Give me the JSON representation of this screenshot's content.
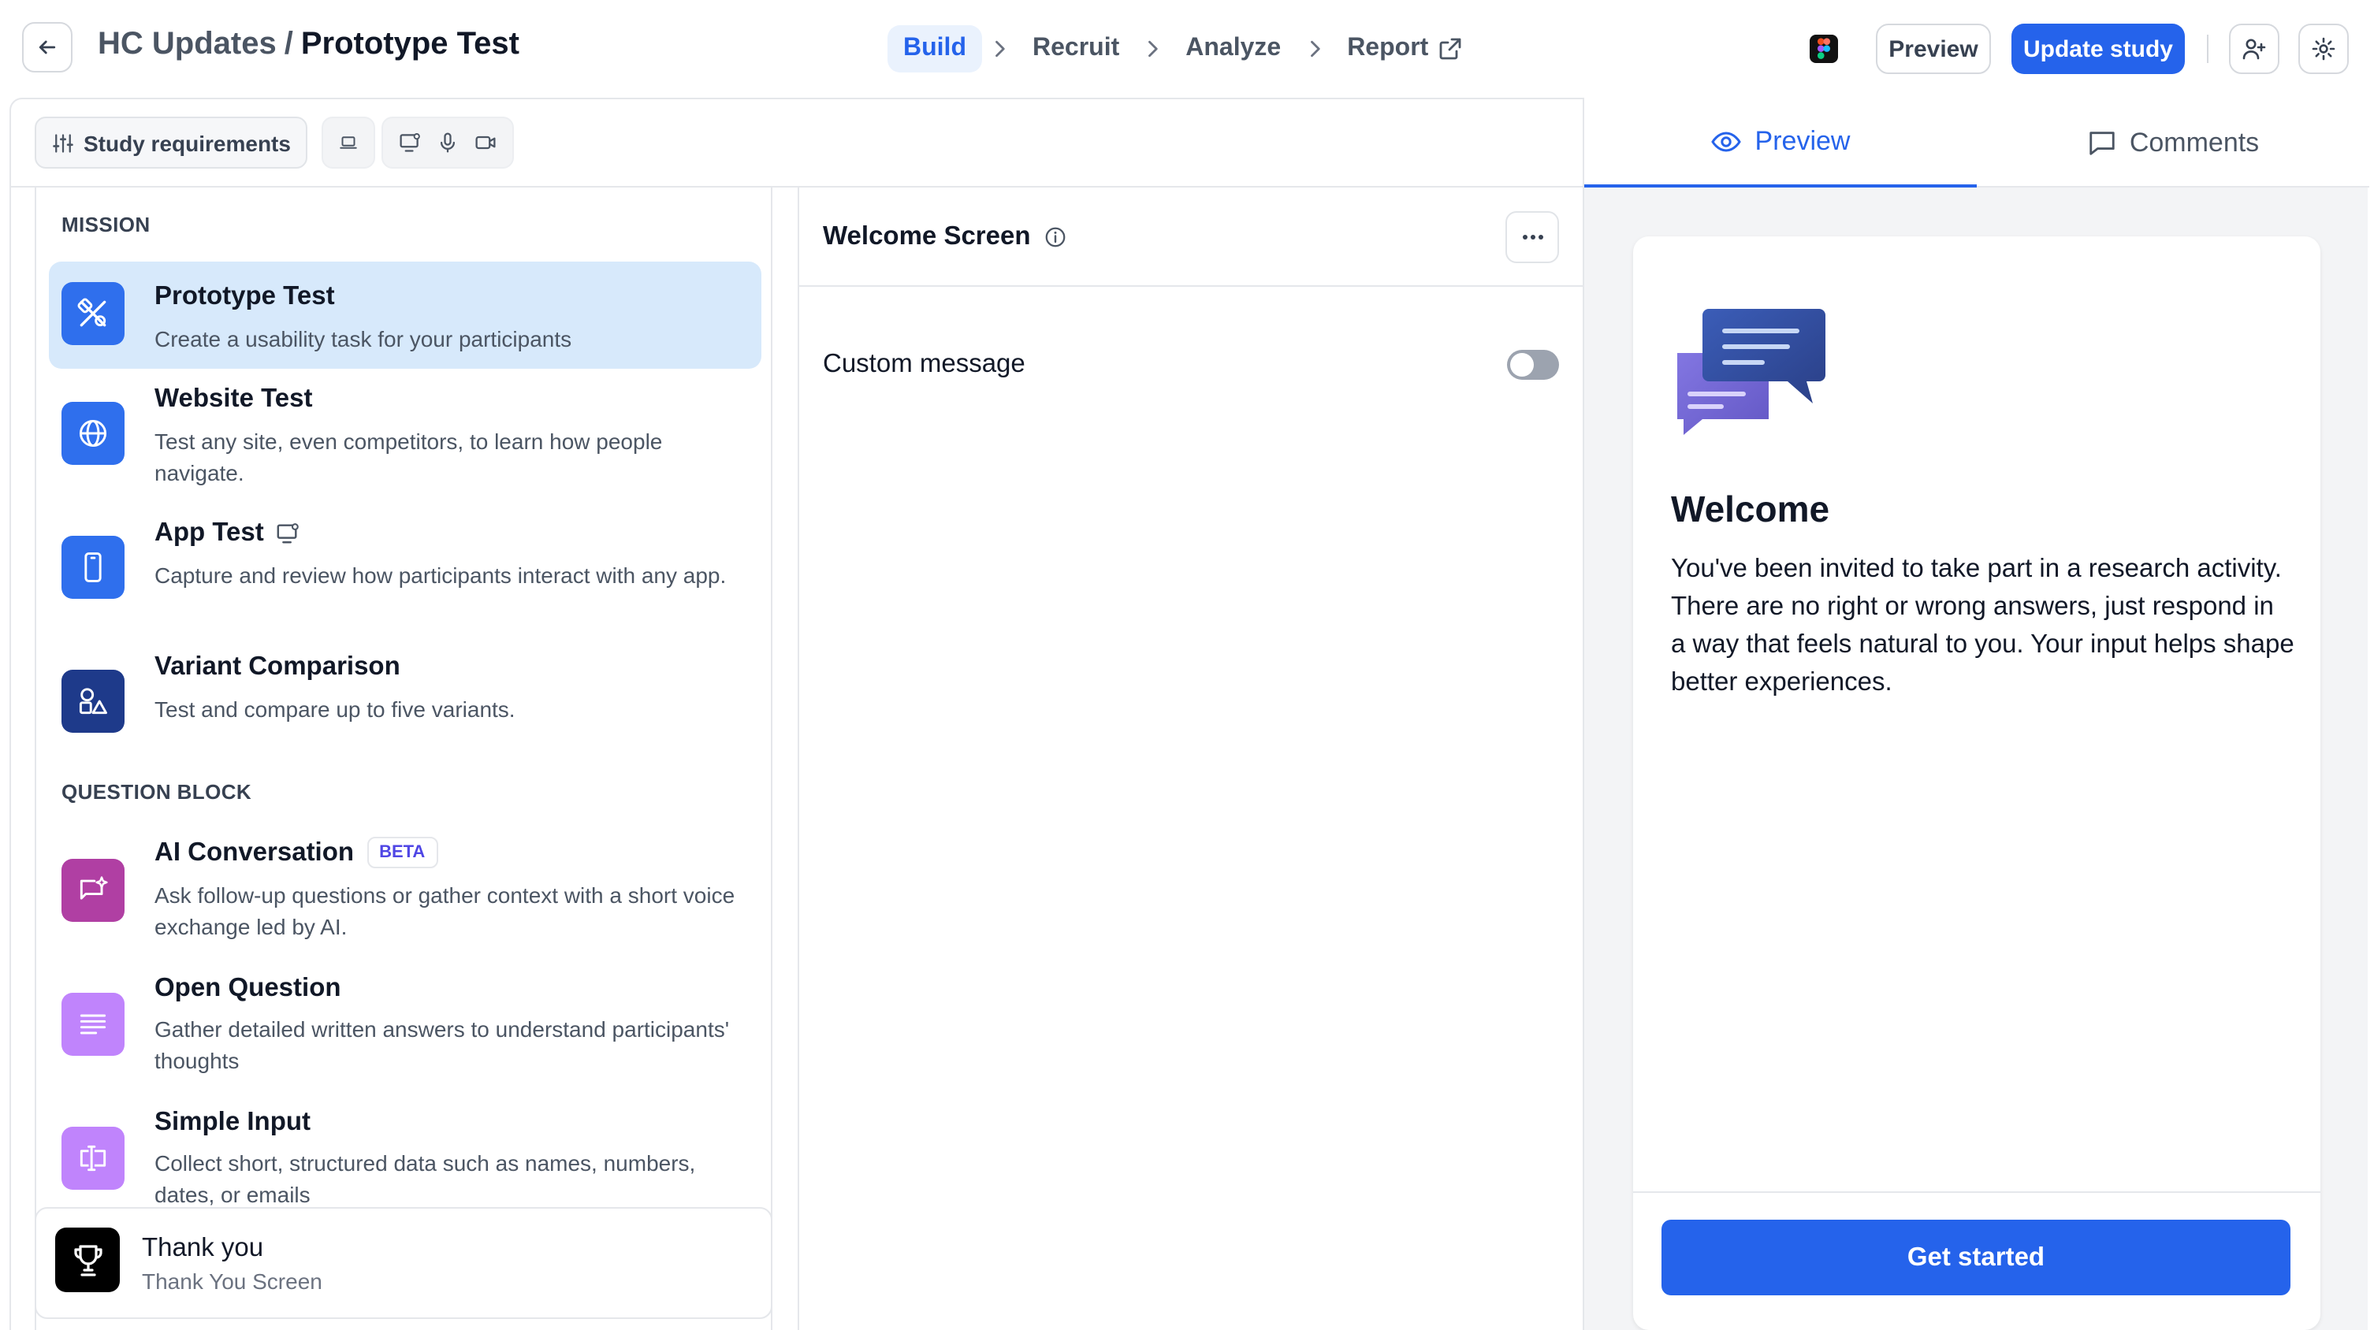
{
  "header": {
    "breadcrumb_parent": "HC Updates",
    "breadcrumb_separator": "/",
    "breadcrumb_current": "Prototype Test",
    "steps": [
      {
        "label": "Build"
      },
      {
        "label": "Recruit"
      },
      {
        "label": "Analyze"
      },
      {
        "label": "Report"
      }
    ],
    "preview_label": "Preview",
    "update_label": "Update study"
  },
  "toolbar": {
    "requirements_label": "Study requirements"
  },
  "mission": {
    "section_label": "MISSION",
    "items": [
      {
        "title": "Prototype Test",
        "desc": "Create a usability task for your participants",
        "icon": "prototype-icon"
      },
      {
        "title": "Website Test",
        "desc": "Test any site, even competitors, to learn how people navigate.",
        "icon": "globe-icon"
      },
      {
        "title": "App Test",
        "desc": "Capture and review how participants interact with any app.",
        "icon": "phone-icon"
      },
      {
        "title": "Variant Comparison",
        "desc": "Test and compare up to five variants.",
        "icon": "shapes-icon"
      }
    ]
  },
  "question_block": {
    "section_label": "QUESTION BLOCK",
    "items": [
      {
        "title": "AI Conversation",
        "badge": "BETA",
        "desc": "Ask follow-up questions or gather context with a short voice exchange led by AI.",
        "icon": "ai-chat-icon"
      },
      {
        "title": "Open Question",
        "desc": "Gather detailed written answers to understand participants' thoughts",
        "icon": "text-lines-icon"
      },
      {
        "title": "Simple Input",
        "desc": "Collect short, structured data such as names, numbers, dates, or emails",
        "icon": "input-cursor-icon"
      }
    ]
  },
  "thank_you": {
    "title": "Thank you",
    "subtitle": "Thank You Screen"
  },
  "editor": {
    "title": "Welcome Screen",
    "custom_message_label": "Custom message",
    "custom_message_enabled": false
  },
  "preview_panel": {
    "tabs": [
      {
        "label": "Preview"
      },
      {
        "label": "Comments"
      }
    ],
    "welcome_title": "Welcome",
    "welcome_body": "You've been invited to take part in a research activity. There are no right or wrong answers, just respond in a way that feels natural to you. Your input helps shape better experiences.",
    "cta_label": "Get started"
  },
  "colors": {
    "accent": "#2563eb",
    "selected_bg": "#d7e9fb",
    "prototype_icon_bg": "#2f6fed",
    "variant_icon_bg": "#1e3a8a",
    "ai_icon_bg": "#b03fa3",
    "open_question_icon_bg": "#c084fc",
    "simple_input_icon_bg": "#c084fc"
  }
}
